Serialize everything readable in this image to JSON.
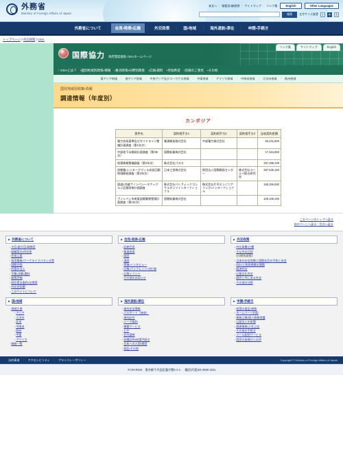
{
  "header": {
    "ministry_jp": "外務省",
    "ministry_en": "Ministry of Foreign Affairs of Japan",
    "util_links": [
      "本文へ",
      "御意見・御感想",
      "サイトマップ",
      "リンク集"
    ],
    "english_button": "English",
    "other_languages_button": "Other Languages",
    "search_placeholder": "",
    "search_value": "",
    "search_button": "検索",
    "fontsize_label": "文字サイズ変更",
    "fontsize_options": [
      "小",
      "中",
      "大"
    ],
    "fontsize_selected": "中"
  },
  "global_nav": {
    "items": [
      {
        "label": "外務省について",
        "active": false
      },
      {
        "label": "会見・発表・広報",
        "active": true
      },
      {
        "label": "外交政策",
        "active": false
      },
      {
        "label": "国・地域",
        "active": false
      },
      {
        "label": "海外渡航・滞在",
        "active": false
      },
      {
        "label": "申請・手続き",
        "active": false
      }
    ]
  },
  "breadcrumb": {
    "items": [
      "トップページ",
      "外交政策",
      "ODA"
    ],
    "separator": "＞"
  },
  "oda_banner": {
    "title": "国際協力",
    "subtitle": "政府開発援助 ODAホームページ",
    "tabs": [
      "リンク集",
      "サイトマップ",
      "English"
    ]
  },
  "oda_nav": {
    "items": [
      "ODAとは？",
      "国別地域別政策・情報",
      "重点政策・分野別政策",
      "広報・資料",
      "参加希望",
      "皆様のご意見",
      "その他"
    ]
  },
  "oda_subnav": {
    "items": [
      "東アジア地域",
      "南アジア地域",
      "中央アジア及びコーカサス地域",
      "中東地域",
      "アフリカ地域",
      "中南米地域",
      "大洋州地域",
      "欧州地域"
    ]
  },
  "page": {
    "kicker": "国別地域別政策・情報",
    "title": "調達情報（年度別）",
    "country": "カンボジア"
  },
  "table": {
    "headers": [
      "案件名",
      "契約相手方1",
      "契約相手方2",
      "契約相手方3",
      "当初契約金額"
    ],
    "rows": [
      {
        "name": "電力技術基準及びガイドライン整備計画調査（第1年次）",
        "p1": "電源開発株式会社",
        "p2": "中部電力株式会社",
        "p3": "",
        "amount": "65,431,800"
      },
      {
        "name": "中部地下水開発計画調査（第3年次）",
        "p1": "国際航業株式会社",
        "p2": "",
        "p3": "",
        "amount": "17,464,650"
      },
      {
        "name": "地理情報整備調査（第3年次）",
        "p1": "株式会社パスコ",
        "p2": "",
        "p3": "",
        "amount": "297,299,100"
      },
      {
        "name": "首都圏・シハヌークヴィル成長回廊地域開発調査（第2年次）",
        "p1": "日本工営株式会社",
        "p2": "財団法人国際開発センター",
        "p3": "株式会社コーエイ総合研究所",
        "amount": "287,535,150"
      },
      {
        "name": "国道1号線プノンペン〜ネアックルン区間改修計画調査",
        "p1": "株式会社パシフィックコンサルタンツインターナショナル",
        "p2": "株式会社片平エンジニアリング・インターナショナル",
        "p3": "",
        "amount": "155,266,650"
      },
      {
        "name": "プノンペン市南東部廃棄物管理計画調査（第1年次）",
        "p1": "国際航業株式会社",
        "p2": "",
        "p3": "",
        "amount": "109,335,450"
      }
    ]
  },
  "pagetop": {
    "top_link": "このページのトップへ戻る",
    "back_links": "前のページへ戻る｜目次へ戻る"
  },
  "sitemap": {
    "columns": [
      {
        "heading": "外務省について",
        "items": [
          "大臣・副大臣・政務官",
          "組織案内・所在地",
          "会長公表",
          "採用情報・ワークライフバランス等",
          "国際企画",
          "所管の法人",
          "予算・決算・資料",
          "政策評価",
          "国会提出条約・法律案",
          "外交史料館",
          "このサイトについて"
        ]
      },
      {
        "heading": "会見・発表・広報",
        "items": [
          "記者会見",
          "報道発表",
          "談話",
          "演説",
          "寄稿・インタビュー",
          "広報・パンフレット・刊行物",
          "広報イベント",
          "その他のお知らせ"
        ]
      },
      {
        "heading": "外交政策",
        "items": [
          "外交青書・白書",
          "主な外交日程",
          "《分野別政策》",
          "日本の安全保障と国際社会の平和と安全",
          "ODAと地球規模の課題",
          "経済外交",
          "広報文化外交",
          "国民と共にある外交",
          "その他の分野"
        ]
      },
      {
        "heading": "国・地域",
        "items": [
          "地域大使",
          "アジア",
          "大洋州",
          "北米",
          "中南米",
          "欧州",
          "中東",
          "アフリカ",
          "情報一覧"
        ]
      },
      {
        "heading": "海外渡航・滞在",
        "items": [
          "海外安全情報",
          "パスポート（旅券）",
          "海外赴任",
          "ハーグ条約",
          "領事サービス",
          "ビザ",
          "在外選挙",
          "各種証明・申請手続き",
          "日本への入国・帰国",
          "訴訟・その他"
        ]
      },
      {
        "heading": "申請・手続き",
        "items": [
          "各国の査証・旅券",
          "ホームページ利用",
          "情報公開・個人情報保護",
          "公益法人の申請",
          "調達情報・入札公告",
          "その他の手続き",
          "メール配信サービス",
          "国民の皆様からの声"
        ]
      }
    ]
  },
  "footer": {
    "links": [
      "法的事項",
      "アクセシビリティ",
      "プライバシーポリシー"
    ],
    "copyright": "Copyright © Ministry of Foreign Affairs of Japan",
    "postal": "〒100-8919　東京都千代田区霞が関2-2-1",
    "tel": "電話(代表)03-3580-3311"
  }
}
